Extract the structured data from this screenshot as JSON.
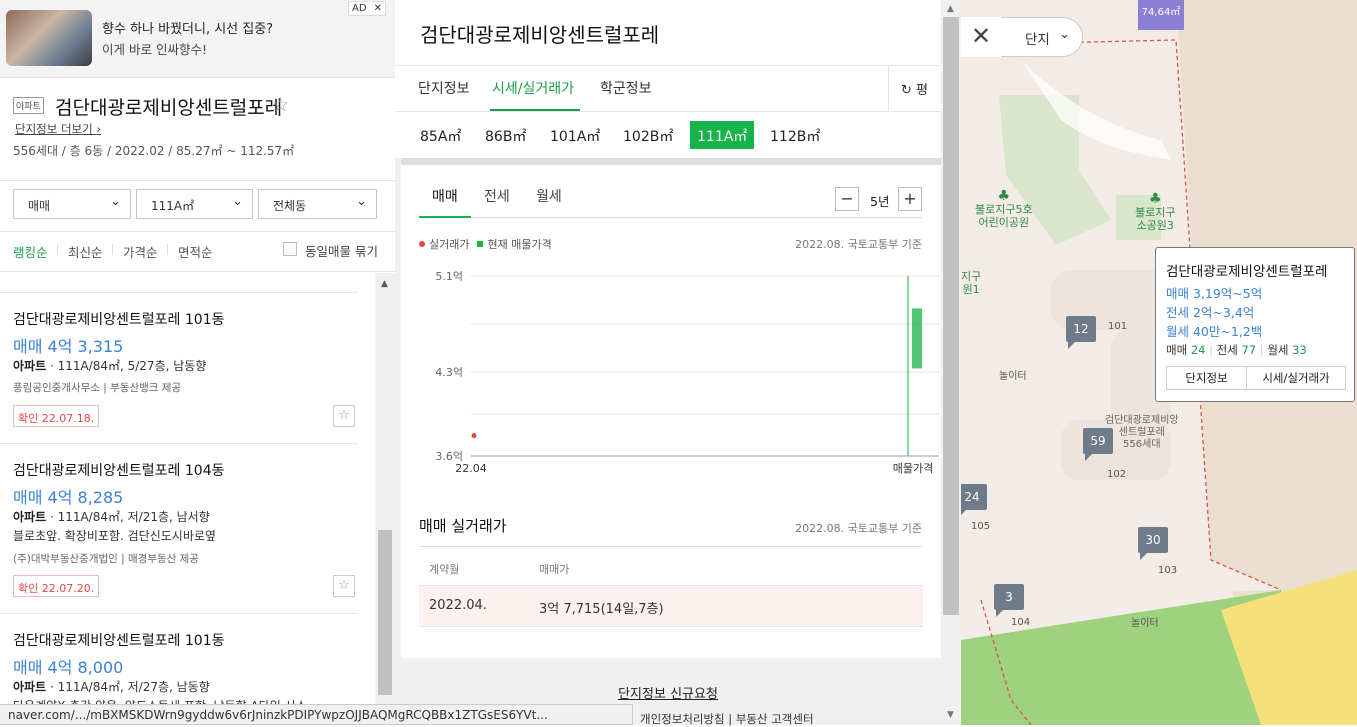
{
  "ad": {
    "headline": "향수 하나 바꿨더니, 시선 집중?",
    "sub": "이게 바로 인싸향수!",
    "tag": "AD",
    "close": "✕"
  },
  "complex": {
    "badge": "아파트",
    "name": "검단대광로제비앙센트럴포레",
    "star": "☆",
    "more": "단지정보 더보기",
    "more_icon": "›",
    "info": "556세대 / 층 6동 / 2022.02 / 85.27㎡ ~ 112.57㎡"
  },
  "filters": {
    "trade": "매매",
    "area": "111A㎡",
    "dong": "전체동",
    "chevron": "⌄"
  },
  "sort": {
    "items": [
      "랭킹순",
      "최신순",
      "가격순",
      "면적순"
    ],
    "same_label": "동일매물 묶기"
  },
  "listings": [
    {
      "name": "검단대광로제비앙센트럴포레 101동",
      "price": "매매 4억 3,315",
      "type": "아파트",
      "spec": " · 111A/84㎡, 5/27층, 남동향",
      "desc": "",
      "agency": "풍림공인중개사무소 | 부동산뱅크 제공",
      "confirm": "확인 22.07.18."
    },
    {
      "name": "검단대광로제비앙센트럴포레 104동",
      "price": "매매 4억 8,285",
      "type": "아파트",
      "spec": " · 111A/84㎡, 저/21층, 남서향",
      "desc": "블로초앞. 확장비포함. 검단신도시바로옆",
      "agency": "(주)대박부동산중개법인 | 매경부동산 제공",
      "confirm": "확인 22.07.20."
    },
    {
      "name": "검단대광로제비앙센트럴포레 101동",
      "price": "매매 4억 8,000",
      "type": "아파트",
      "spec": " · 111A/84㎡, 저/27층, 남동향",
      "desc": "다운계약X 층간 양음. 양도소득세 포함. 남동향 A타입 시스",
      "agency": "",
      "confirm": ""
    }
  ],
  "panel": {
    "title": "검단대광로제비앙센트럴포레",
    "tabs": [
      "단지정보",
      "시세/실거래가",
      "학군정보"
    ],
    "pyeong": "평",
    "pyeong_icon": "↻",
    "areas": [
      "85A㎡",
      "86B㎡",
      "101A㎡",
      "102B㎡",
      "111A㎡",
      "112B㎡"
    ],
    "active_area_index": 4,
    "trade_tabs": [
      "매매",
      "전세",
      "월세"
    ],
    "minus": "−",
    "plus": "+",
    "period": "5년",
    "legend_real": "실거래가",
    "legend_current": "현재 매물가격",
    "source": "2022.08. 국토교통부 기준",
    "section_title": "매매 실거래가",
    "table_headers": [
      "계약월",
      "매매가"
    ],
    "table_rows": [
      [
        "2022.04.",
        "3억 7,715(14일,7층)"
      ]
    ],
    "new_request": "단지정보 신규요청"
  },
  "chart_data": {
    "type": "scatter",
    "title": "",
    "xlabel": "",
    "ylabel": "",
    "y_ticks": [
      "5.1억",
      "4.3억",
      "3.6억"
    ],
    "x_ticks": [
      "22.04",
      "매물가격"
    ],
    "ylim": [
      3.6,
      5.1
    ],
    "y_unit": "억",
    "series": [
      {
        "name": "실거래가",
        "color": "#ef4444",
        "points": [
          {
            "x": "22.04",
            "y": 3.77
          }
        ]
      },
      {
        "name": "현재 매물가격",
        "color": "#14b44a",
        "range": [
          4.33,
          4.83
        ]
      }
    ]
  },
  "map": {
    "close": "✕",
    "danji": "단지",
    "chev": "⌄",
    "price_tag": "74,64㎡",
    "parks": [
      {
        "name": "불로지구5호\n어린이공원"
      },
      {
        "name": "불로지구\n소공원3"
      },
      {
        "name": "지구\n원1"
      }
    ],
    "markers": [
      {
        "count": "12"
      },
      {
        "count": "59"
      },
      {
        "count": "24"
      },
      {
        "count": "30"
      },
      {
        "count": "3"
      }
    ],
    "labels": [
      "101",
      "놀이터",
      "102",
      "105",
      "103",
      "104",
      "놀이터"
    ],
    "complex_label": "검단대광로제비앙\n센트럴포레\n556세대",
    "popup": {
      "title": "검단대광로제비앙센트럴포레",
      "sale": "매매 3,19억~5억",
      "jeonse": "전세 2억~3,4억",
      "monthly": "월세 40만~1,2백",
      "cnt_sale_label": "매매",
      "cnt_sale": "24",
      "cnt_jeonse_label": "전세",
      "cnt_jeonse": "77",
      "cnt_monthly_label": "월세",
      "cnt_monthly": "33",
      "btn1": "단지정보",
      "btn2": "시세/실거래가"
    }
  },
  "status_url": "naver.com/.../mBXMSKDWrn9gyddw6v6rJninzkPDIPYwpzOJJBAQMgRCQBBx1ZTGsES6YVt...",
  "bottom_links": "개인정보처리방침 | 부동산 고객센터",
  "colors": {
    "accent": "#1e9e4a",
    "price": "#3b82d6",
    "active_area": "#14b44a",
    "confirm": "#e64646"
  }
}
